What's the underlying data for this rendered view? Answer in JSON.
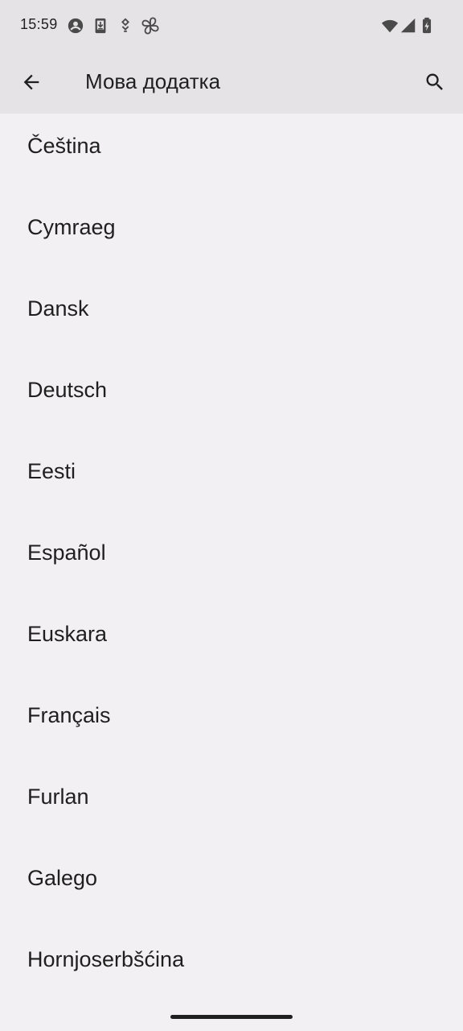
{
  "status_bar": {
    "time": "15:59",
    "icons": [
      "account-circle-icon",
      "download-icon",
      "assistant-icon",
      "pinwheel-icon",
      "wifi-icon",
      "signal-icon",
      "battery-charging-icon"
    ]
  },
  "app_bar": {
    "title": "Мова додатка",
    "back_icon": "arrow-back-icon",
    "search_icon": "search-icon"
  },
  "languages": [
    {
      "label": "Čeština"
    },
    {
      "label": "Cymraeg"
    },
    {
      "label": "Dansk"
    },
    {
      "label": "Deutsch"
    },
    {
      "label": "Eesti"
    },
    {
      "label": "Español"
    },
    {
      "label": "Euskara"
    },
    {
      "label": "Français"
    },
    {
      "label": "Furlan"
    },
    {
      "label": "Galego"
    },
    {
      "label": "Hornjoserbšćina"
    }
  ],
  "colors": {
    "background": "#f2f0f2",
    "top_bar": "#e5e3e6",
    "text": "#1f1f1f"
  }
}
